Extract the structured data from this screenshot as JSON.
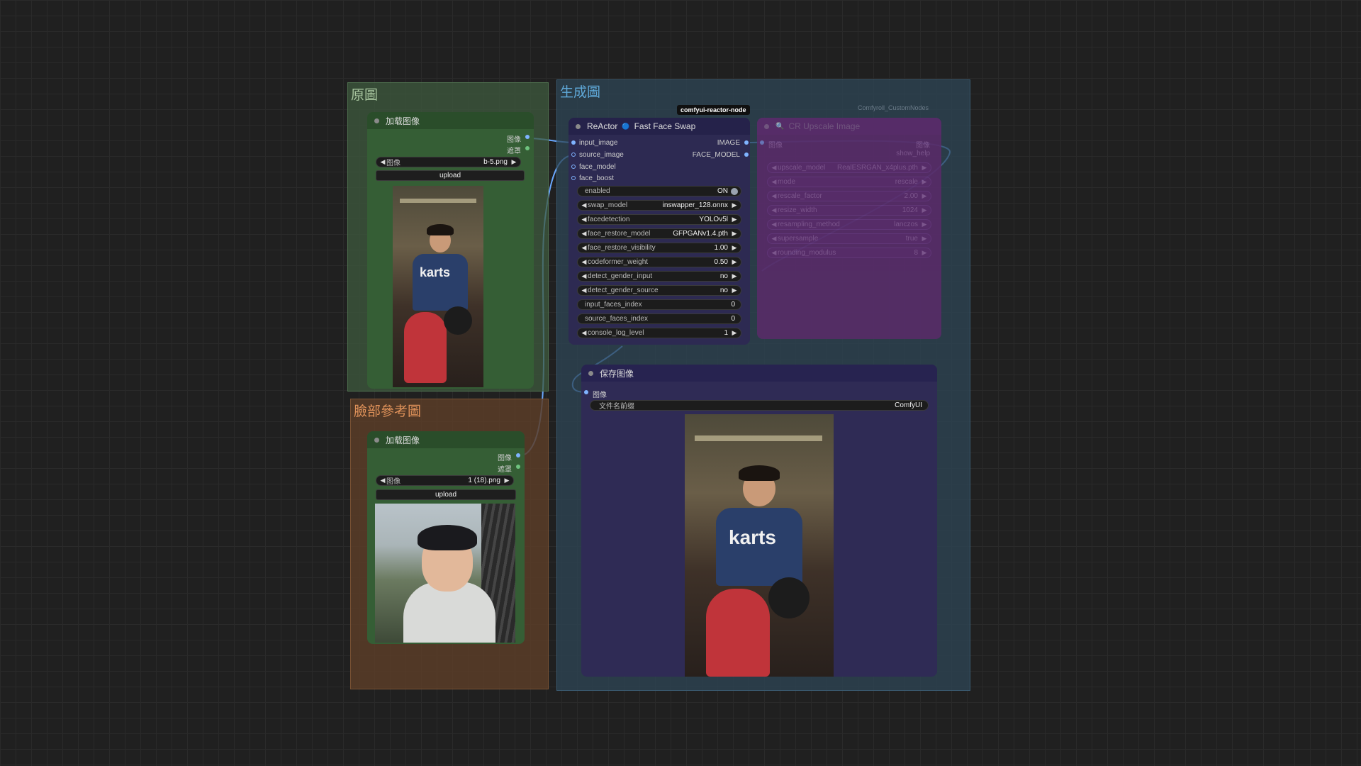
{
  "groups": {
    "original": {
      "title": "原圖",
      "color": "#3d5a3d"
    },
    "face_ref": {
      "title": "臉部參考圖",
      "color": "#5a3d28"
    },
    "generated": {
      "title": "生成圖",
      "color": "#2d4656"
    }
  },
  "load_image_1": {
    "title": "加载图像",
    "out_image": "图像",
    "out_mask": "遮罩",
    "image_label": "图像",
    "image_value": "b-5.png",
    "upload": "upload"
  },
  "load_image_2": {
    "title": "加载图像",
    "out_image": "图像",
    "out_mask": "遮罩",
    "image_label": "图像",
    "image_value": "1 (18).png",
    "upload": "upload"
  },
  "reactor": {
    "badge": "comfyui-reactor-node",
    "title_prefix": "ReActor",
    "title_icon": "🔵",
    "title": "Fast Face Swap",
    "inputs": [
      "input_image",
      "source_image",
      "face_model",
      "face_boost"
    ],
    "outputs": [
      "IMAGE",
      "FACE_MODEL"
    ],
    "widgets": [
      {
        "label": "enabled",
        "value": "ON",
        "type": "toggle"
      },
      {
        "label": "swap_model",
        "value": "inswapper_128.onnx",
        "type": "combo"
      },
      {
        "label": "facedetection",
        "value": "YOLOv5l",
        "type": "combo"
      },
      {
        "label": "face_restore_model",
        "value": "GFPGANv1.4.pth",
        "type": "combo"
      },
      {
        "label": "face_restore_visibility",
        "value": "1.00",
        "type": "number"
      },
      {
        "label": "codeformer_weight",
        "value": "0.50",
        "type": "number"
      },
      {
        "label": "detect_gender_input",
        "value": "no",
        "type": "combo"
      },
      {
        "label": "detect_gender_source",
        "value": "no",
        "type": "combo"
      },
      {
        "label": "input_faces_index",
        "value": "0",
        "type": "text"
      },
      {
        "label": "source_faces_index",
        "value": "0",
        "type": "text"
      },
      {
        "label": "console_log_level",
        "value": "1",
        "type": "number"
      }
    ]
  },
  "upscale": {
    "badge": "Comfyroll_CustomNodes",
    "title": "CR Upscale Image",
    "in_image": "图像",
    "out_image": "图像",
    "out_help": "show_help",
    "widgets": [
      {
        "label": "upscale_model",
        "value": "RealESRGAN_x4plus.pth"
      },
      {
        "label": "mode",
        "value": "rescale"
      },
      {
        "label": "rescale_factor",
        "value": "2.00"
      },
      {
        "label": "resize_width",
        "value": "1024"
      },
      {
        "label": "resampling_method",
        "value": "lanczos"
      },
      {
        "label": "supersample",
        "value": "true"
      },
      {
        "label": "rounding_modulus",
        "value": "8"
      }
    ]
  },
  "save_image": {
    "title": "保存图像",
    "in_image": "图像",
    "prefix_label": "文件名前缀",
    "prefix_value": "ComfyUI"
  },
  "colors": {
    "load_node": "#2f5a2f",
    "load_node_body": "#355e35",
    "reactor_node": "#2d2a52",
    "save_node": "#2f2b55",
    "upscale_node": "#5b2a6a",
    "link": "#6aa8ff"
  }
}
